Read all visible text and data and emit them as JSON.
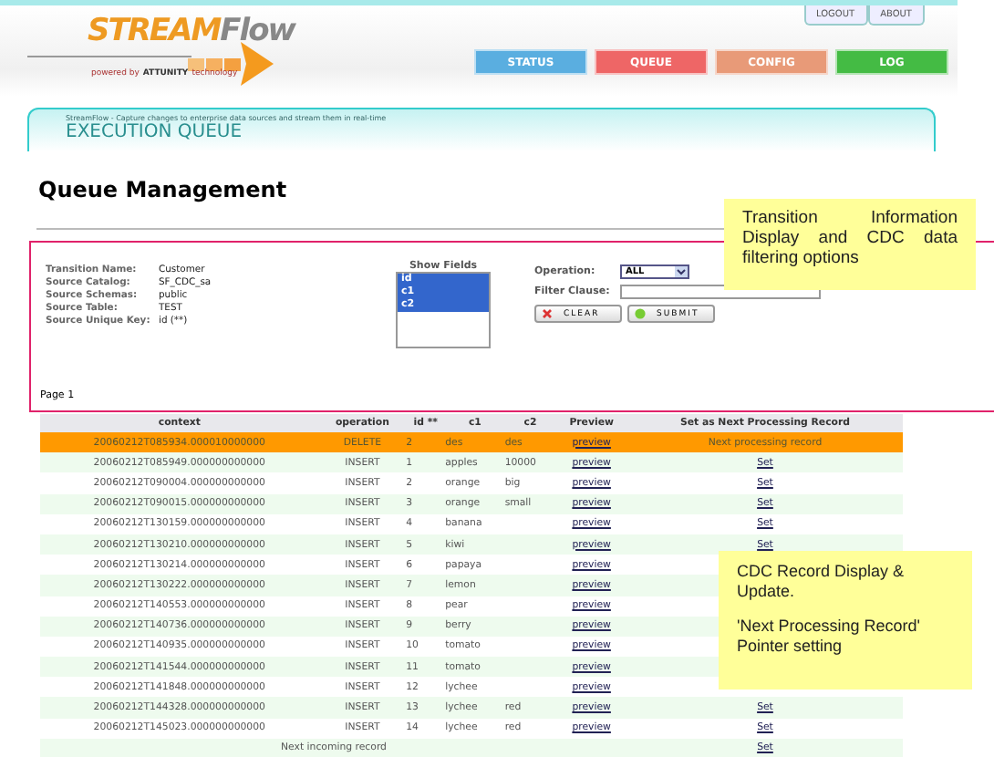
{
  "top_links": [
    "LOGOUT",
    "ABOUT"
  ],
  "logo": {
    "word_1": "STREAM",
    "word_2": "Flow",
    "powered_by": "powered by",
    "brand": "ATTUNITY",
    "technology": "technology"
  },
  "nav": [
    {
      "label": "STATUS",
      "color": "#5aaee0"
    },
    {
      "label": "QUEUE",
      "color": "#ee6666"
    },
    {
      "label": "CONFIG",
      "color": "#e89a78"
    },
    {
      "label": "LOG",
      "color": "#44bb44"
    }
  ],
  "banner": {
    "subtitle": "StreamFlow - Capture changes to enterprise data sources and stream them in real-time",
    "title": "EXECUTION QUEUE"
  },
  "heading": "Queue Management",
  "info": [
    {
      "label": "Transition Name:",
      "value": "Customer"
    },
    {
      "label": "Source Catalog:",
      "value": "SF_CDC_sa"
    },
    {
      "label": "Source Schemas:",
      "value": "public"
    },
    {
      "label": "Source Table:",
      "value": "TEST"
    },
    {
      "label": "Source Unique Key:",
      "value": "id (**)"
    }
  ],
  "show_fields": {
    "label": "Show Fields",
    "items": [
      {
        "label": "id",
        "selected": true
      },
      {
        "label": "c1",
        "selected": true
      },
      {
        "label": "c2",
        "selected": true
      }
    ]
  },
  "operation": {
    "label": "Operation:",
    "value": "ALL"
  },
  "filter": {
    "label": "Filter Clause:"
  },
  "buttons": [
    "CLEAR",
    "SUBMIT"
  ],
  "page": "Page 1",
  "table": {
    "columns": [
      "context",
      "operation",
      "id **",
      "c1",
      "c2",
      "Preview",
      "Set as Next Processing Record"
    ],
    "rows": [
      {
        "context": "20060212T085934.000010000000",
        "operation": "DELETE",
        "id": "2",
        "c1": "des",
        "c2": "des",
        "preview": "preview",
        "set": "Next processing record",
        "selected": true
      },
      {
        "context": "20060212T085949.000000000000",
        "operation": "INSERT",
        "id": "1",
        "c1": "apples",
        "c2": "10000",
        "preview": "preview",
        "set": "Set",
        "selected": false
      },
      {
        "context": "20060212T090004.000000000000",
        "operation": "INSERT",
        "id": "2",
        "c1": "orange",
        "c2": "big",
        "preview": "preview",
        "set": "Set",
        "selected": false
      },
      {
        "context": "20060212T090015.000000000000",
        "operation": "INSERT",
        "id": "3",
        "c1": "orange",
        "c2": "small",
        "preview": "preview",
        "set": "Set",
        "selected": false
      },
      {
        "context": "20060212T130159.000000000000",
        "operation": "INSERT",
        "id": "4",
        "c1": "banana",
        "preview": "preview",
        "set": "Set",
        "selected": false
      },
      {
        "context": "20060212T130210.000000000000",
        "operation": "INSERT",
        "id": "5",
        "c1": "kiwi",
        "preview": "preview",
        "set": "Set",
        "selected": false
      },
      {
        "context": "20060212T130214.000000000000",
        "operation": "INSERT",
        "id": "6",
        "c1": "papaya",
        "preview": "preview",
        "selected": false
      },
      {
        "context": "20060212T130222.000000000000",
        "operation": "INSERT",
        "id": "7",
        "c1": "lemon",
        "preview": "preview",
        "selected": false
      },
      {
        "context": "20060212T140553.000000000000",
        "operation": "INSERT",
        "id": "8",
        "c1": "pear",
        "preview": "preview",
        "selected": false
      },
      {
        "context": "20060212T140736.000000000000",
        "operation": "INSERT",
        "id": "9",
        "c1": "berry",
        "preview": "preview",
        "selected": false
      },
      {
        "context": "20060212T140935.000000000000",
        "operation": "INSERT",
        "id": "10",
        "c1": "tomato",
        "preview": "preview",
        "selected": false
      },
      {
        "context": "20060212T141544.000000000000",
        "operation": "INSERT",
        "id": "11",
        "c1": "tomato",
        "preview": "preview",
        "selected": false
      },
      {
        "context": "20060212T141848.000000000000",
        "operation": "INSERT",
        "id": "12",
        "c1": "lychee",
        "preview": "preview",
        "selected": false
      },
      {
        "context": "20060212T144328.000000000000",
        "operation": "INSERT",
        "id": "13",
        "c1": "lychee",
        "c2": "red",
        "preview": "preview",
        "set": "Set",
        "selected": false
      },
      {
        "context": "20060212T145023.000000000000",
        "operation": "INSERT",
        "id": "14",
        "c1": "lychee",
        "c2": "red",
        "preview": "preview",
        "set": "Set",
        "selected": false
      }
    ],
    "footer": {
      "label": "Next incoming record",
      "set": "Set"
    }
  },
  "callouts": [
    {
      "text": "Transition Information Display and CDC data filtering options"
    },
    {
      "lines": [
        "CDC Record Display & Update.",
        "'Next Processing Record' Pointer setting"
      ]
    }
  ]
}
